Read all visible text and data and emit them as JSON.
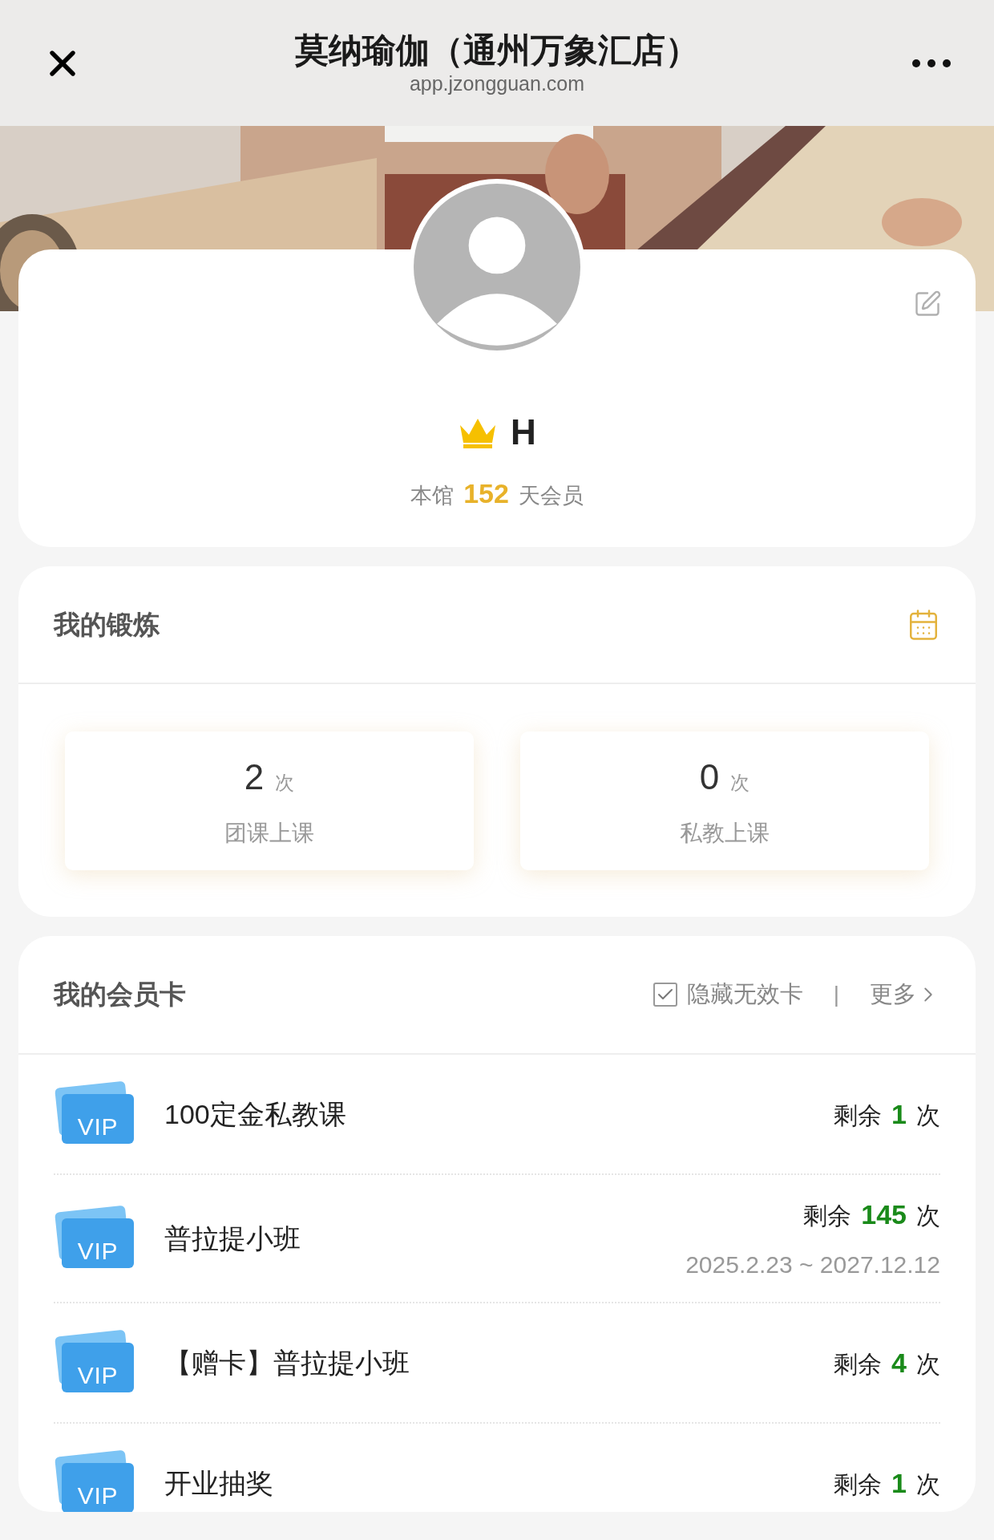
{
  "header": {
    "title": "莫纳瑜伽（通州万象汇店）",
    "url": "app.jzongguan.com"
  },
  "profile": {
    "name": "H",
    "vip": true,
    "membership_prefix": "本馆",
    "membership_days": "152",
    "membership_suffix": "天会员"
  },
  "exercise": {
    "title": "我的锻炼",
    "stats": [
      {
        "value": "2",
        "unit": "次",
        "label": "团课上课"
      },
      {
        "value": "0",
        "unit": "次",
        "label": "私教上课"
      }
    ]
  },
  "cards": {
    "title": "我的会员卡",
    "hide_invalid": {
      "label": "隐藏无效卡",
      "checked": true
    },
    "separator": "|",
    "more": "更多",
    "items": [
      {
        "badge": "VIP",
        "name": "100定金私教课",
        "prefix": "剩余",
        "count": "1",
        "suffix": "次"
      },
      {
        "badge": "VIP",
        "name": "普拉提小班",
        "prefix": "剩余",
        "count": "145",
        "suffix": "次",
        "period": "2025.2.23 ~ 2027.12.12"
      },
      {
        "badge": "VIP",
        "name": "【赠卡】普拉提小班",
        "prefix": "剩余",
        "count": "4",
        "suffix": "次"
      },
      {
        "badge": "VIP",
        "name": "开业抽奖",
        "prefix": "剩余",
        "count": "1",
        "suffix": "次"
      }
    ]
  }
}
